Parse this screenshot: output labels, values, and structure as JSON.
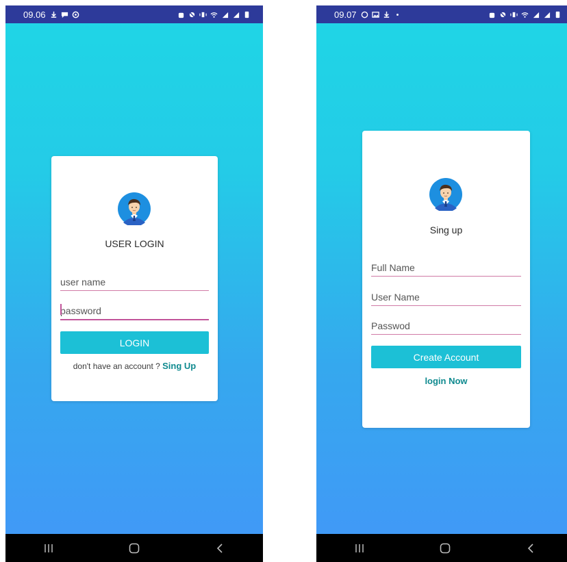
{
  "login_screen": {
    "status_bar": {
      "time": "09.06",
      "left_icons": [
        "download-icon",
        "chat-icon",
        "location-icon"
      ],
      "right_icons": [
        "alarm-icon",
        "silent-icon",
        "vibrate-icon",
        "wifi-icon",
        "signal-icon",
        "signal-icon",
        "battery-icon"
      ]
    },
    "card": {
      "title": "USER LOGIN",
      "username_placeholder": "user name",
      "password_placeholder": "password",
      "login_label": "LOGIN",
      "prompt_text": "don't have an account ?",
      "signup_link": "Sing Up"
    }
  },
  "signup_screen": {
    "status_bar": {
      "time": "09.07",
      "left_icons": [
        "whatsapp-icon",
        "gallery-icon",
        "download-icon",
        "dot-icon"
      ],
      "right_icons": [
        "alarm-icon",
        "silent-icon",
        "vibrate-icon",
        "wifi-icon",
        "signal-icon",
        "signal-icon",
        "battery-icon"
      ]
    },
    "card": {
      "title": "Sing up",
      "fullname_placeholder": "Full Name",
      "username_placeholder": "User Name",
      "password_placeholder": "Passwod",
      "create_label": "Create Account",
      "login_link": "login Now"
    }
  },
  "colors": {
    "status_bar": "#2d3a9a",
    "gradient_top": "#1fd6e6",
    "gradient_bottom": "#4297f8",
    "button": "#1cc0d6",
    "link": "#0f8a8f",
    "field_underline": "#d07aa6"
  }
}
